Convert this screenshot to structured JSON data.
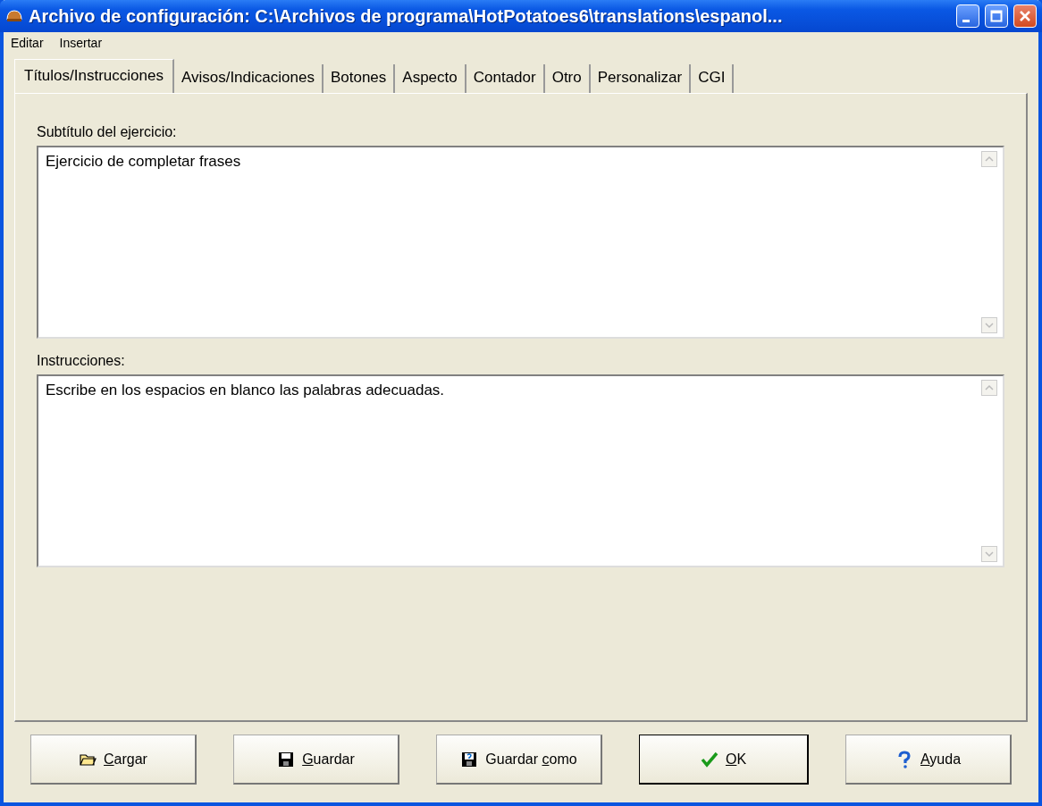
{
  "window": {
    "title": "Archivo de configuración: C:\\Archivos de programa\\HotPotatoes6\\translations\\espanol..."
  },
  "menu": [
    "Editar",
    "Insertar"
  ],
  "tabs": [
    {
      "label": "Títulos/Instrucciones",
      "selected": true
    },
    {
      "label": "Avisos/Indicaciones",
      "selected": false
    },
    {
      "label": "Botones",
      "selected": false
    },
    {
      "label": "Aspecto",
      "selected": false
    },
    {
      "label": "Contador",
      "selected": false
    },
    {
      "label": "Otro",
      "selected": false
    },
    {
      "label": "Personalizar",
      "selected": false
    },
    {
      "label": "CGI",
      "selected": false
    }
  ],
  "fields": [
    {
      "label": "Subtítulo del ejercicio:",
      "value": "Ejercicio de completar frases"
    },
    {
      "label": "Instrucciones:",
      "value": "Escribe en los espacios en blanco las palabras adecuadas."
    }
  ],
  "buttons": [
    {
      "kind": "open",
      "key": "C",
      "post": "argar",
      "default": false
    },
    {
      "kind": "save",
      "key": "G",
      "post": "uardar",
      "default": false
    },
    {
      "kind": "saveas",
      "pre": "Guardar ",
      "key": "c",
      "post": "omo",
      "default": false
    },
    {
      "kind": "ok",
      "key": "O",
      "post": "K",
      "default": true
    },
    {
      "kind": "help",
      "key": "A",
      "post": "yuda",
      "default": false
    }
  ]
}
